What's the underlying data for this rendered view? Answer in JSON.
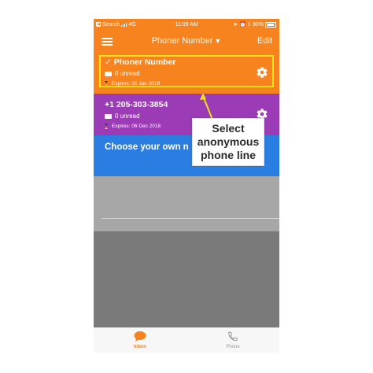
{
  "status_bar": {
    "carrier": "Search",
    "network": "4G",
    "time": "11:09 AM",
    "battery": "90%"
  },
  "nav": {
    "title": "Phoner Number",
    "caret": "▼",
    "edit_label": "Edit"
  },
  "lines": [
    {
      "check": "✓",
      "name": "Phoner Number",
      "unread": "0 unread",
      "expires": "Expires: 05 Jan 2019"
    },
    {
      "name": "+1 205-303-3854",
      "unread": "0 unread",
      "expires": "Expires: 06 Dec 2018"
    }
  ],
  "choose_text": "Choose your own n",
  "tabs": [
    {
      "label": "Inbox"
    },
    {
      "label": "Phone"
    }
  ],
  "callout": {
    "line1": "Select",
    "line2": "anonymous",
    "line3": "phone line"
  },
  "colors": {
    "orange": "#f7831f",
    "purple": "#9b3bb5",
    "blue": "#2a7de1",
    "highlight": "#f0e21a"
  }
}
